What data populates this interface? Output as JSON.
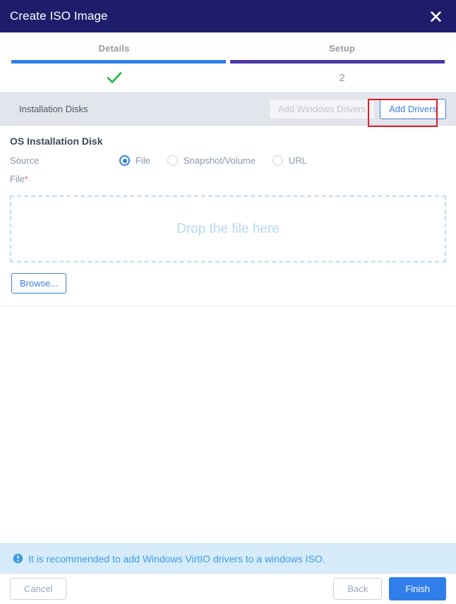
{
  "titlebar": {
    "title": "Create ISO Image",
    "close_icon": "close-icon"
  },
  "wizard": {
    "steps": [
      {
        "label": "Details",
        "marker": "",
        "state": "completed",
        "bar_color": "#2f7eea",
        "marker_icon": "check-icon"
      },
      {
        "label": "Setup",
        "marker": "2",
        "state": "active",
        "bar_color": "#4b35a8",
        "marker_icon": ""
      }
    ]
  },
  "section": {
    "title": "Installation Disks",
    "buttons": {
      "add_windows_drivers": "Add Windows Drivers",
      "add_drivers": "Add Drivers"
    },
    "highlight_color": "#e01b24"
  },
  "form": {
    "block_title": "OS Installation Disk",
    "source": {
      "label": "Source",
      "options": [
        {
          "label": "File",
          "selected": true
        },
        {
          "label": "Snapshot/Volume",
          "selected": false
        },
        {
          "label": "URL",
          "selected": false
        }
      ]
    },
    "file": {
      "label": "File",
      "required_mark": "*",
      "dropzone_text": "Drop the file here",
      "browse_label": "Browse..."
    }
  },
  "info_banner": {
    "icon": "info-circle-icon",
    "text": "It is recommended to add Windows VirtIO drivers to a windows ISO.",
    "color": "#3e9ae8"
  },
  "footer": {
    "cancel_label": "Cancel",
    "back_label": "Back",
    "finish_label": "Finish",
    "primary_color": "#2f7eea"
  }
}
